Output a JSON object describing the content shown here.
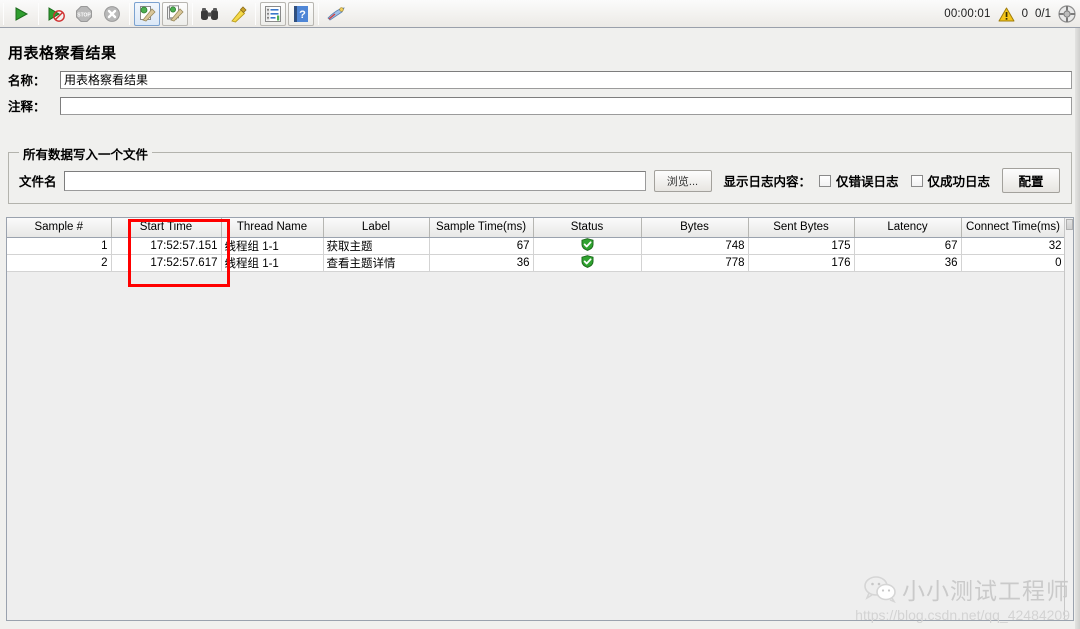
{
  "toolbar": {
    "buttons": [
      {
        "name": "start-button",
        "icon": "green-play-icon"
      },
      {
        "name": "start-no-timers-button",
        "icon": "play-no-timers-icon"
      },
      {
        "name": "stop-button",
        "icon": "stop-icon"
      },
      {
        "name": "shutdown-button",
        "icon": "shutdown-x-icon"
      },
      {
        "name": "clear-button",
        "icon": "broom-page-icon"
      },
      {
        "name": "clear-all-button",
        "icon": "broom-pages-icon"
      },
      {
        "name": "search-button",
        "icon": "binoculars-icon"
      },
      {
        "name": "reset-search-button",
        "icon": "broom-icon"
      },
      {
        "name": "function-helper-button",
        "icon": "list-icon"
      },
      {
        "name": "help-button",
        "icon": "help-book-icon"
      },
      {
        "name": "templates-button",
        "icon": "templates-icon"
      }
    ],
    "status": {
      "elapsed": "00:00:01",
      "warning_icon": "warning-triangle-icon",
      "error_count": "0",
      "threads": "0/1",
      "threads_icon": "thread-gauge-icon"
    }
  },
  "panel": {
    "title": "用表格察看结果",
    "name_label": "名称：",
    "name_value": "用表格察看结果",
    "comment_label": "注释：",
    "comment_value": "",
    "comment_placeholder": ""
  },
  "filegroup": {
    "legend": "所有数据写入一个文件",
    "filename_label": "文件名",
    "filename_value": "",
    "browse_button": "浏览...",
    "log_display_label": "显示日志内容：",
    "errors_only_label": "仅错误日志",
    "errors_only_checked": false,
    "success_only_label": "仅成功日志",
    "success_only_checked": false,
    "configure_button": "配置"
  },
  "table": {
    "columns": [
      "Sample #",
      "Start Time",
      "Thread Name",
      "Label",
      "Sample Time(ms)",
      "Status",
      "Bytes",
      "Sent Bytes",
      "Latency",
      "Connect Time(ms)"
    ],
    "rows": [
      {
        "sample": "1",
        "start_time": "17:52:57.151",
        "thread_name": "线程组 1-1",
        "label": "获取主题",
        "sample_time": "67",
        "status": "success",
        "bytes": "748",
        "sent_bytes": "175",
        "latency": "67",
        "connect_time": "32"
      },
      {
        "sample": "2",
        "start_time": "17:52:57.617",
        "thread_name": "线程组 1-1",
        "label": "查看主题详情",
        "sample_time": "36",
        "status": "success",
        "bytes": "778",
        "sent_bytes": "176",
        "latency": "36",
        "connect_time": "0"
      }
    ]
  },
  "annotation": {
    "name": "start-time-highlight",
    "color": "#ff0000"
  },
  "watermark": {
    "icon": "wechat-icon",
    "name": "小小测试工程师",
    "url": "https://blog.csdn.net/qq_42484209"
  }
}
